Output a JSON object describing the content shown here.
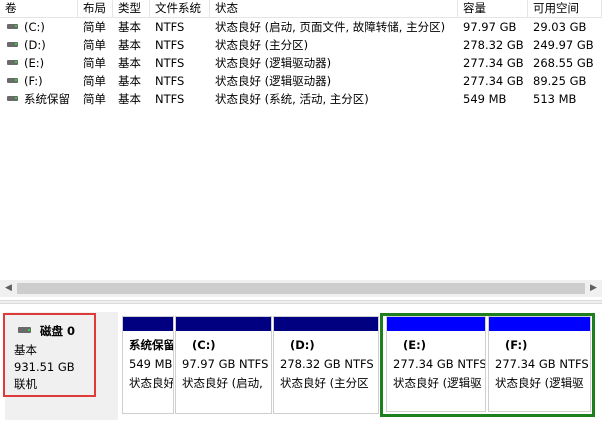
{
  "columns": {
    "volume": "卷",
    "layout": "布局",
    "type": "类型",
    "filesystem": "文件系统",
    "status": "状态",
    "capacity": "容量",
    "free": "可用空间"
  },
  "volumes": [
    {
      "volume": "(C:)",
      "layout": "简单",
      "type": "基本",
      "fs": "NTFS",
      "status": "状态良好 (启动, 页面文件, 故障转储, 主分区)",
      "capacity": "97.97 GB",
      "free": "29.03 GB"
    },
    {
      "volume": "(D:)",
      "layout": "简单",
      "type": "基本",
      "fs": "NTFS",
      "status": "状态良好 (主分区)",
      "capacity": "278.32 GB",
      "free": "249.97 GB"
    },
    {
      "volume": "(E:)",
      "layout": "简单",
      "type": "基本",
      "fs": "NTFS",
      "status": "状态良好 (逻辑驱动器)",
      "capacity": "277.34 GB",
      "free": "268.55 GB"
    },
    {
      "volume": "(F:)",
      "layout": "简单",
      "type": "基本",
      "fs": "NTFS",
      "status": "状态良好 (逻辑驱动器)",
      "capacity": "277.34 GB",
      "free": "89.25 GB"
    },
    {
      "volume": "系统保留",
      "layout": "简单",
      "type": "基本",
      "fs": "NTFS",
      "status": "状态良好 (系统, 活动, 主分区)",
      "capacity": "549 MB",
      "free": "513 MB"
    }
  ],
  "scrollbar": {
    "left_arrow": "◀",
    "right_arrow": "▶"
  },
  "disk": {
    "name": "磁盘 0",
    "type": "基本",
    "size": "931.51 GB",
    "status": "联机"
  },
  "partitions": [
    {
      "name": "系统保留",
      "size": "549 MB",
      "status": "状态良好",
      "bar_color": "#000080"
    },
    {
      "name": "(C:)",
      "size": "97.97 GB NTFS",
      "status": "状态良好 (启动,",
      "bar_color": "#000080"
    },
    {
      "name": "(D:)",
      "size": "278.32 GB NTFS",
      "status": "状态良好 (主分区",
      "bar_color": "#000080"
    },
    {
      "name": "(E:)",
      "size": "277.34 GB NTFS",
      "status": "状态良好 (逻辑驱",
      "bar_color": "#0000ff"
    },
    {
      "name": "(F:)",
      "size": "277.34 GB NTFS",
      "status": "状态良好 (逻辑驱",
      "bar_color": "#0000ff"
    }
  ],
  "colors": {
    "primary_partition": "#000080",
    "logical_drive": "#0000ff",
    "extended_partition_frame": "#1e7f1e",
    "selection_highlight": "#e03b3b"
  }
}
